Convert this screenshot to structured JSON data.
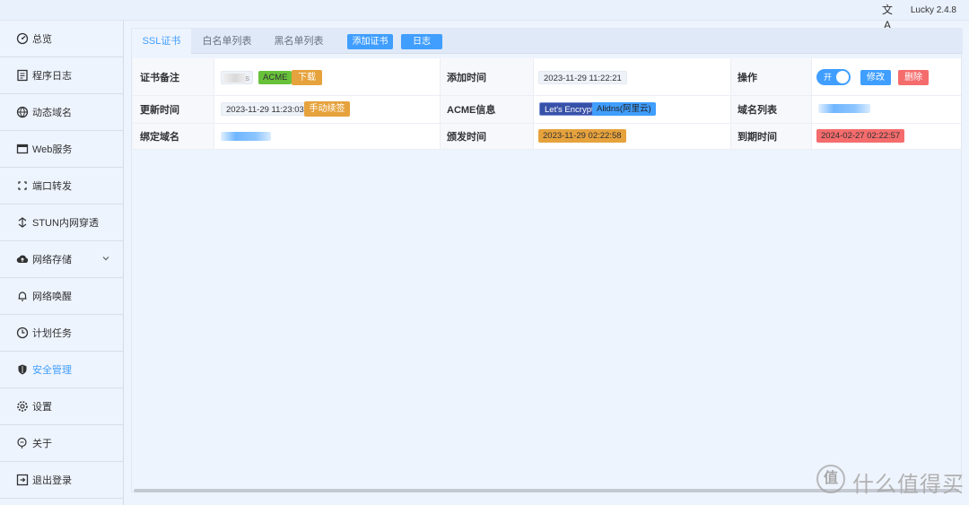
{
  "topbar": {
    "version": "Lucky 2.4.8",
    "translate_icon": "translate-icon",
    "translate_glyph": "文A"
  },
  "sidebar": {
    "items": [
      {
        "label": "总览",
        "icon": "dashboard-icon"
      },
      {
        "label": "程序日志",
        "icon": "log-icon"
      },
      {
        "label": "动态域名",
        "icon": "ddns-icon"
      },
      {
        "label": "Web服务",
        "icon": "web-icon"
      },
      {
        "label": "端口转发",
        "icon": "port-forward-icon"
      },
      {
        "label": "STUN内网穿透",
        "icon": "stun-icon"
      },
      {
        "label": "网络存储",
        "icon": "cloud-storage-icon"
      },
      {
        "label": "网络唤醒",
        "icon": "bell-icon"
      },
      {
        "label": "计划任务",
        "icon": "clock-icon"
      },
      {
        "label": "安全管理",
        "icon": "shield-icon",
        "active": true
      },
      {
        "label": "设置",
        "icon": "gear-icon"
      },
      {
        "label": "关于",
        "icon": "about-icon"
      },
      {
        "label": "退出登录",
        "icon": "logout-icon"
      }
    ]
  },
  "tabs": {
    "ssl": "SSL证书",
    "whitelist": "白名单列表",
    "blacklist": "黑名单列表",
    "add_cert": "添加证书",
    "log": "日志"
  },
  "cert": {
    "labels": {
      "remark": "证书备注",
      "add_time": "添加时间",
      "operation": "操作",
      "update_time": "更新时间",
      "acme_info": "ACME信息",
      "domain_list": "域名列表",
      "bound_domain": "绑定域名",
      "issue_time": "颁发时间",
      "expire_time": "到期时间"
    },
    "remark_suffix": "s",
    "acme_tag": "ACME",
    "download": "下载",
    "add_time_value": "2023-11-29 11:22:21",
    "switch_label": "开",
    "edit": "修改",
    "delete": "删除",
    "update_time_value": "2023-11-29 11:23:03",
    "manual_renew": "手动续签",
    "acme_provider": "Let's Encrypt",
    "acme_dns": "Alidns(阿里云)",
    "issue_time_value": "2023-11-29 02:22:58",
    "expire_time_value": "2024-02-27 02:22:57"
  },
  "colors": {
    "primary": "#409eff",
    "success": "#67c23a",
    "warning": "#e6a23c",
    "danger": "#f56c6c"
  },
  "watermark": {
    "text": "什么值得买",
    "logo_glyph": "值"
  }
}
